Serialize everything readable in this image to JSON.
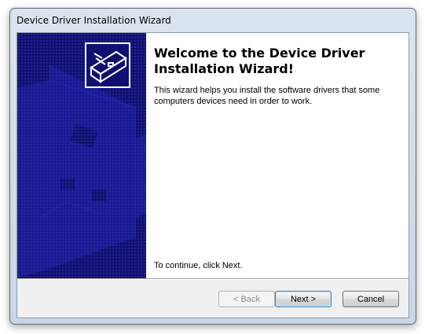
{
  "window": {
    "title": "Device Driver Installation Wizard"
  },
  "wizard": {
    "heading": "Welcome to the Device Driver Installation Wizard!",
    "intro": "This wizard helps you install the software drivers that some computers devices need in order to work.",
    "continue_hint": "To continue, click Next."
  },
  "buttons": {
    "back_label": "< Back",
    "next_label": "Next >",
    "cancel_label": "Cancel"
  },
  "colors": {
    "banner_bg": "#101070",
    "banner_shape": "#1c1c9c"
  }
}
